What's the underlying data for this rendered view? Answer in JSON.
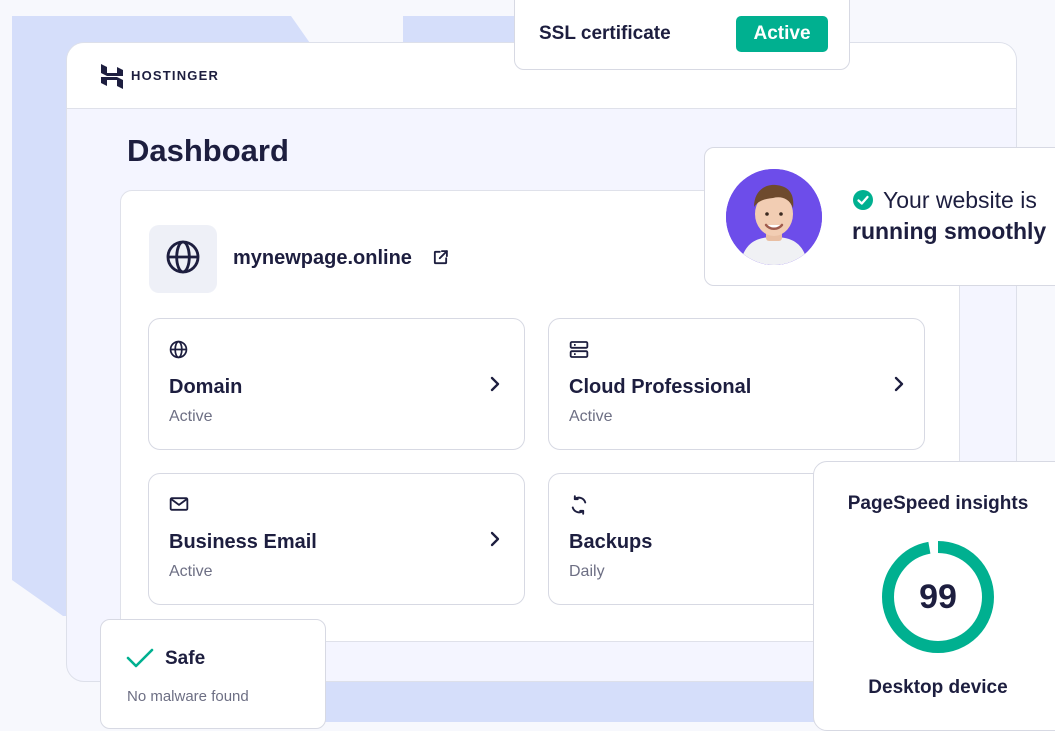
{
  "brand": {
    "name": "HOSTINGER"
  },
  "page": {
    "title": "Dashboard"
  },
  "site": {
    "name": "mynewpage.online",
    "icon": "globe-icon",
    "link_icon": "external-link-icon"
  },
  "services": [
    {
      "title": "Domain",
      "status": "Active",
      "icon": "globe-icon"
    },
    {
      "title": "Cloud Professional",
      "status": "Active",
      "icon": "server-icon"
    },
    {
      "title": "Business Email",
      "status": "Active",
      "icon": "mail-icon"
    },
    {
      "title": "Backups",
      "status": "Daily",
      "icon": "refresh-icon"
    }
  ],
  "ssl": {
    "label": "SSL certificate",
    "status": "Active"
  },
  "status_card": {
    "line1": "Your website is",
    "line2": "running smoothly",
    "icon": "check-circle-icon"
  },
  "pagespeed": {
    "title": "PageSpeed insights",
    "score": "99",
    "device": "Desktop device"
  },
  "security": {
    "title": "Safe",
    "subtitle": "No malware found",
    "icon": "check-icon"
  },
  "colors": {
    "accent": "#00b090",
    "text": "#1d1e3f",
    "avatar_bg": "#6d4dea",
    "background_shape": "#d5defa"
  }
}
